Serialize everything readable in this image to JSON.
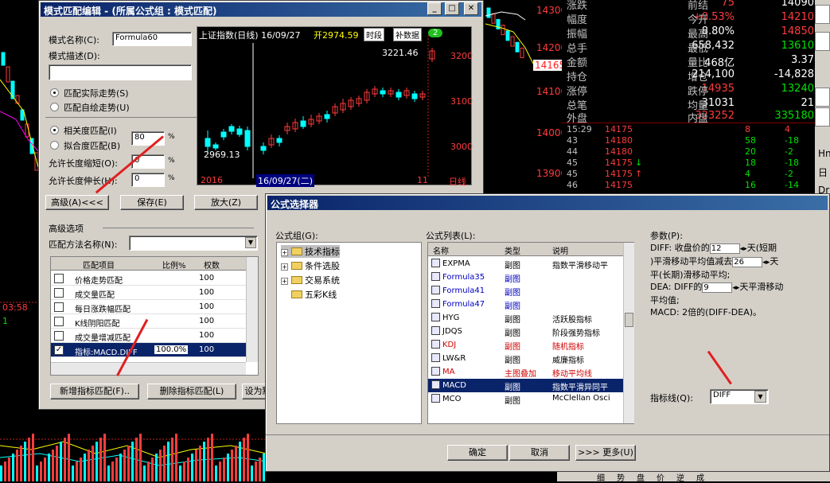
{
  "left_dialog": {
    "title": "模式匹配编辑 - (所属公式组 : 模式匹配)",
    "model_name_label": "模式名称(C):",
    "model_name_value": "Formula60",
    "model_desc_label": "模式描述(D):",
    "radio_actual": "匹配实际走势(S)",
    "radio_draw": "匹配自绘走势(U)",
    "radio_corr": "相关度匹配(I)",
    "radio_fit": "拟合度匹配(B)",
    "corr_value": "80",
    "pct": "%",
    "shrink_label": "允许长度缩短(O):",
    "shrink_value": "0",
    "stretch_label": "允许长度伸长(H):",
    "stretch_value": "0",
    "btn_advanced": "高级(A)<<<",
    "btn_save": "保存(E)",
    "btn_zoom": "放大(Z)",
    "advanced_group": "高级选项",
    "method_label": "匹配方法名称(N):",
    "table_headers": [
      "匹配项目",
      "比例%",
      "权数"
    ],
    "table_rows": [
      {
        "name": "价格走势匹配",
        "ratio": "",
        "weight": "100",
        "checked": ""
      },
      {
        "name": "成交量匹配",
        "ratio": "",
        "weight": "100",
        "checked": ""
      },
      {
        "name": "每日涨跌幅匹配",
        "ratio": "",
        "weight": "100",
        "checked": ""
      },
      {
        "name": "K线阴阳匹配",
        "ratio": "",
        "weight": "100",
        "checked": ""
      },
      {
        "name": "成交量增减匹配",
        "ratio": "",
        "weight": "100",
        "checked": ""
      },
      {
        "name": "指标:MACD.DIFF",
        "ratio": "100.0%",
        "weight": "100",
        "checked": "✓"
      }
    ],
    "btn_add": "新增指标匹配(F)..",
    "btn_delete": "删除指标匹配(L)",
    "btn_set": "设为默"
  },
  "mini_chart": {
    "title": "上证指数(日线) 16/09/27",
    "open_label": "开2974.59",
    "btn_period": "时段",
    "btn_refill": "补数据",
    "badge": "2",
    "high_label": "3221.46",
    "low_label": "2969.13",
    "yticks": [
      "3200",
      "3100",
      "3000"
    ],
    "footer_left": "2016",
    "footer_date": "16/09/27(二)",
    "footer_mid": "11",
    "footer_right": "日线"
  },
  "formula_dialog": {
    "title": "公式选择器",
    "group_label": "公式组(G):",
    "tree": [
      "技术指标",
      "条件选股",
      "交易系统",
      "五彩K线"
    ],
    "list_label": "公式列表(L):",
    "list_headers": [
      "名称",
      "类型",
      "说明"
    ],
    "list_rows": [
      {
        "name": "EXPMA",
        "type": "副图",
        "desc": "指数平滑移动平",
        "color": "#000"
      },
      {
        "name": "Formula35",
        "type": "副图",
        "desc": "",
        "color": "#0000c0"
      },
      {
        "name": "Formula41",
        "type": "副图",
        "desc": "",
        "color": "#0000c0"
      },
      {
        "name": "Formula47",
        "type": "副图",
        "desc": "",
        "color": "#0000c0"
      },
      {
        "name": "HYG",
        "type": "副图",
        "desc": "活跃股指标",
        "color": "#000"
      },
      {
        "name": "JDQS",
        "type": "副图",
        "desc": "阶段强势指标",
        "color": "#000"
      },
      {
        "name": "KDJ",
        "type": "副图",
        "desc": "随机指标",
        "color": "#d00000"
      },
      {
        "name": "LW&R",
        "type": "副图",
        "desc": "威廉指标",
        "color": "#000"
      },
      {
        "name": "MA",
        "type": "主图叠加",
        "desc": "移动平均线",
        "color": "#d00000"
      },
      {
        "name": "MACD",
        "type": "副图",
        "desc": "指数平滑异同平",
        "color": "#fff"
      },
      {
        "name": "MCO",
        "type": "副图",
        "desc": "McClellan Osci",
        "color": "#000"
      }
    ],
    "params_label": "参数(P):",
    "param_line1_a": "DIFF: 收盘价的",
    "param_12": "12",
    "param_line1_b": "天(短期",
    "param_line2_a": ")平滑移动平均值减去",
    "param_26": "26",
    "param_line2_b": "天",
    "param_line3": "平(长期)滑移动平均;",
    "param_line4_a": "DEA: DIFF的",
    "param_9": "9",
    "param_line4_b": "天平滑移动",
    "param_line5": "平均值;",
    "param_line6": "MACD: 2倍的(DIFF-DEA)。",
    "line_label": "指标线(Q):",
    "line_value": "DIFF",
    "btn_ok": "确定",
    "btn_cancel": "取消",
    "btn_more": ">>> 更多(U)"
  },
  "quote_panel": {
    "rows": [
      {
        "l1": "涨跌",
        "v1": "75",
        "l2": "前结",
        "v2": "14090"
      },
      {
        "l1": "幅度",
        "v1": "+0.53%",
        "l2": "今开",
        "v2": "14210"
      },
      {
        "l1": "振幅",
        "v1": "8.80%",
        "l2": "最高",
        "v2": "14850"
      },
      {
        "l1": "总手",
        "v1": "658,432",
        "l2": "最低",
        "v2": "13610"
      },
      {
        "l1": "金额",
        "v1": "468亿",
        "l2": "量比",
        "v2": "3.37"
      },
      {
        "l1": "持仓",
        "v1": "214,100",
        "l2": "增仓",
        "v2": "-14,828"
      },
      {
        "l1": "涨停",
        "v1": "14935",
        "l2": "跌停",
        "v2": "13240"
      },
      {
        "l1": "总笔",
        "v1": "31031",
        "l2": "均量",
        "v2": "21"
      },
      {
        "l1": "外盘",
        "v1": "323252",
        "l2": "内盘",
        "v2": "335180"
      }
    ],
    "ticks": [
      {
        "t": "15:29",
        "p": "14175",
        "a": "",
        "v": "8",
        "d": "4"
      },
      {
        "t": "43",
        "p": "14180",
        "a": "",
        "v": "58",
        "d": "-18"
      },
      {
        "t": "44",
        "p": "14180",
        "a": "",
        "v": "20",
        "d": "-2"
      },
      {
        "t": "45",
        "p": "14175",
        "a": "↓",
        "v": "18",
        "d": "-18"
      },
      {
        "t": "45",
        "p": "14175",
        "a": "↑",
        "v": "4",
        "d": "-2"
      },
      {
        "t": "46",
        "p": "14175",
        "a": "",
        "v": "16",
        "d": "-14"
      }
    ],
    "price_axis": [
      "14300",
      "14200",
      "14100",
      "14000",
      "13900"
    ],
    "price_marker": "14165",
    "side_letters": [
      "Hn",
      "日",
      "Dr"
    ]
  },
  "bottom_bar": [
    "细",
    "势",
    "盘",
    "价",
    "逆",
    "成"
  ],
  "bg_labels": {
    "time": "03:58",
    "num": "1"
  },
  "colors": {
    "title_blue": "#0a246a",
    "dialog_gray": "#d4d0c8",
    "up_red": "#ff3c3c",
    "down_green": "#00e000"
  }
}
